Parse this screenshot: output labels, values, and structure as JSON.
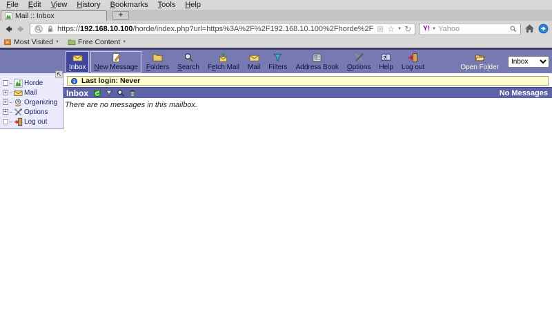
{
  "browser": {
    "menu_items": [
      {
        "label": "File",
        "accel": 0
      },
      {
        "label": "Edit",
        "accel": 0
      },
      {
        "label": "View",
        "accel": 0
      },
      {
        "label": "History",
        "accel": 0
      },
      {
        "label": "Bookmarks",
        "accel": 0
      },
      {
        "label": "Tools",
        "accel": 0
      },
      {
        "label": "Help",
        "accel": 0
      }
    ],
    "tab": {
      "title": "Mail :: Inbox",
      "favicon": "horde-favicon"
    },
    "new_tab_label": "+",
    "url": {
      "scheme": "https://",
      "domain": "192.168.10.100",
      "path": "/horde/index.php?url=https%3A%2F%2F192.168.10.100%2Fhorde%2F"
    },
    "nav_icons": [
      "back-icon",
      "forward-icon",
      "site-identity-icon",
      "lock-icon",
      "bookmark-add-icon",
      "star-icon",
      "dropdown-caret-icon",
      "reload-icon",
      "home-icon",
      "addon-icon"
    ],
    "search": {
      "engine_label": "Y!",
      "placeholder": "Yahoo",
      "icon": "search-small-icon"
    },
    "bookmarks": [
      {
        "label": "Most Visited",
        "icon": "most-visited-icon"
      },
      {
        "label": "Free Content",
        "icon": "green-folder-icon"
      }
    ]
  },
  "horde": {
    "accent_colors": {
      "toolbar": "#7679b2",
      "selected": "#3f459b",
      "header": "#5c63a6",
      "alert_bg": "#ffffce",
      "sidebar_bg": "#eaeafa"
    },
    "toolbar": {
      "items": [
        {
          "label": "Inbox",
          "icon": "inbox-icon",
          "accel": 0,
          "selected": true
        },
        {
          "label": "New Message",
          "icon": "compose-icon",
          "accel": 0,
          "outlined": true
        },
        {
          "label": "Folders",
          "icon": "folder-icon",
          "accel": 0
        },
        {
          "label": "Search",
          "icon": "search-icon",
          "accel": 0
        },
        {
          "label": "Fetch Mail",
          "icon": "fetchmail-icon",
          "accel": 1
        },
        {
          "label": "Mail",
          "icon": "mail-icon",
          "accel": -1
        },
        {
          "label": "Filters",
          "icon": "filter-icon",
          "accel": -1
        },
        {
          "label": "Address Book",
          "icon": "addressbook-icon",
          "accel": -1
        },
        {
          "label": "Options",
          "icon": "options-icon",
          "accel": 0
        },
        {
          "label": "Help",
          "icon": "help-icon",
          "accel": -1
        },
        {
          "label": "Log out",
          "icon": "logout-icon",
          "accel": -1
        }
      ],
      "open_folder": {
        "label": "Open Folder",
        "icon": "openfolder-icon",
        "accel": 7
      },
      "folder_select_value": "Inbox"
    },
    "sidebar": {
      "items": [
        {
          "label": "Horde",
          "icon": "horde-icon",
          "expandable": false
        },
        {
          "label": "Mail",
          "icon": "mail-icon",
          "expandable": true
        },
        {
          "label": "Organizing",
          "icon": "organizing-icon",
          "expandable": true
        },
        {
          "label": "Options",
          "icon": "options-icon",
          "expandable": true
        },
        {
          "label": "Log out",
          "icon": "logout-icon",
          "expandable": false
        }
      ],
      "collapse_icon": "collapse-icon"
    },
    "notification": {
      "text": "Last login: Never",
      "icon": "info-icon"
    },
    "mailbox": {
      "title": "Inbox",
      "header_icons": [
        "refresh-icon",
        "filter-caret-icon",
        "search-dark-icon",
        "trash-icon"
      ],
      "status": "No Messages",
      "empty_message": "There are no messages in this mailbox."
    }
  }
}
